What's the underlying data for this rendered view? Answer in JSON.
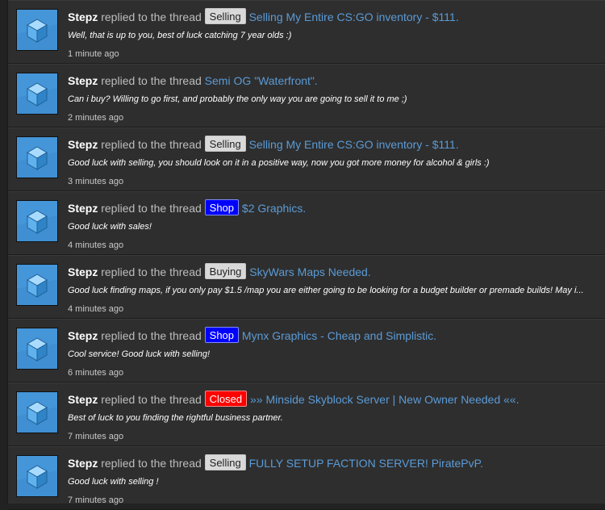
{
  "feed": {
    "items": [
      {
        "user": "Stepz",
        "action": "replied to the thread",
        "label": "Selling",
        "label_type": "selling",
        "thread": "Selling My Entire CS:GO inventory - $111",
        "snippet": "Well, that is up to you, best of luck catching 7 year olds :)",
        "time": "1 minute ago"
      },
      {
        "user": "Stepz",
        "action": "replied to the thread",
        "label": "",
        "label_type": "",
        "thread": "Semi OG \"Waterfront\"",
        "snippet": "Can i buy? Willing to go first, and probably the only way you are going to sell it to me ;)",
        "time": "2 minutes ago"
      },
      {
        "user": "Stepz",
        "action": "replied to the thread",
        "label": "Selling",
        "label_type": "selling",
        "thread": "Selling My Entire CS:GO inventory - $111",
        "snippet": "Good luck with selling, you should look on it in a positive way, now you got more money for alcohol & girls :)",
        "time": "3 minutes ago"
      },
      {
        "user": "Stepz",
        "action": "replied to the thread",
        "label": "Shop",
        "label_type": "shop",
        "thread": "$2 Graphics",
        "snippet": "Good luck with sales!",
        "time": "4 minutes ago"
      },
      {
        "user": "Stepz",
        "action": "replied to the thread",
        "label": "Buying",
        "label_type": "buying",
        "thread": "SkyWars Maps Needed",
        "snippet": "Good luck finding maps, if you only pay $1.5 /map you are either going to be looking for a budget builder or premade builds! May i...",
        "time": "4 minutes ago"
      },
      {
        "user": "Stepz",
        "action": "replied to the thread",
        "label": "Shop",
        "label_type": "shop",
        "thread": "Mynx Graphics - Cheap and Simplistic",
        "snippet": "Cool service! Good luck with selling!",
        "time": "6 minutes ago"
      },
      {
        "user": "Stepz",
        "action": "replied to the thread",
        "label": "Closed",
        "label_type": "closed",
        "thread": "»» Minside Skyblock Server | New Owner Needed ««",
        "snippet": "Best of luck to you finding the rightful business partner.",
        "time": "7 minutes ago"
      },
      {
        "user": "Stepz",
        "action": "replied to the thread",
        "label": "Selling",
        "label_type": "selling",
        "thread": "FULLY SETUP FACTION SERVER! PiratePvP",
        "snippet": "Good luck with selling !",
        "time": "7 minutes ago"
      }
    ]
  },
  "colors": {
    "page_bg": "#222222",
    "item_bg": "#2e2e2e",
    "link": "#5b9bd6",
    "avatar_bg": "#3f8fd2",
    "shop": "#0000ff",
    "closed": "#ff0000",
    "selling": "#d9d9d9"
  },
  "icons": {
    "avatar": "cube-avatar-icon"
  }
}
